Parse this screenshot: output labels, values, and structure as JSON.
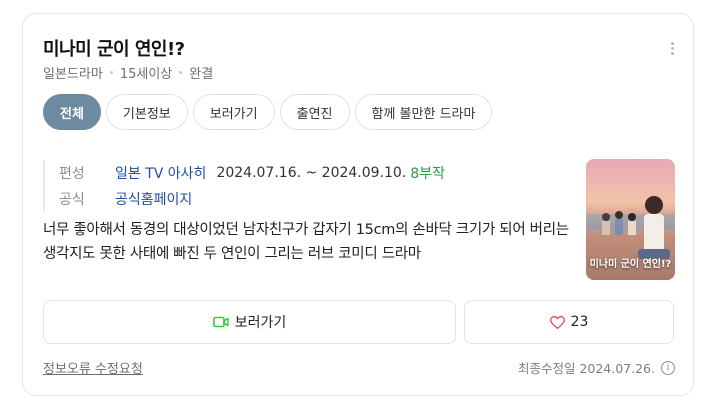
{
  "title": "미나미 군이 연인!?",
  "meta": [
    "일본드라마",
    "15세이상",
    "완결"
  ],
  "tabs": [
    {
      "label": "전체",
      "active": true
    },
    {
      "label": "기본정보"
    },
    {
      "label": "보러가기"
    },
    {
      "label": "출연진"
    },
    {
      "label": "함께 볼만한 드라마"
    }
  ],
  "info": {
    "broadcast_label": "편성",
    "broadcaster": "일본 TV 아사히",
    "period": "2024.07.16. ~ 2024.09.10.",
    "episodes": "8부작",
    "official_label": "공식",
    "official_link": "공식홈페이지"
  },
  "description": "너무 좋아해서 동경의 대상이었던 남자친구가 갑자기 15cm의 손바닥 크기가 되어 버리는 생각지도 못한 사태에 빠진 두 연인이 그리는 러브 코미디 드라마",
  "poster": {
    "title": "미나미 군이 연인!?"
  },
  "buttons": {
    "watch": "보러가기",
    "like_count": "23"
  },
  "footer": {
    "report": "정보오류 수정요청",
    "updated": "최종수정일 2024.07.26."
  },
  "colors": {
    "active_tab": "#6e8aa0",
    "link": "#1d4fa8",
    "episodes": "#2a9d3c",
    "heart": "#e0474c",
    "watch_icon": "#2ecc40"
  }
}
